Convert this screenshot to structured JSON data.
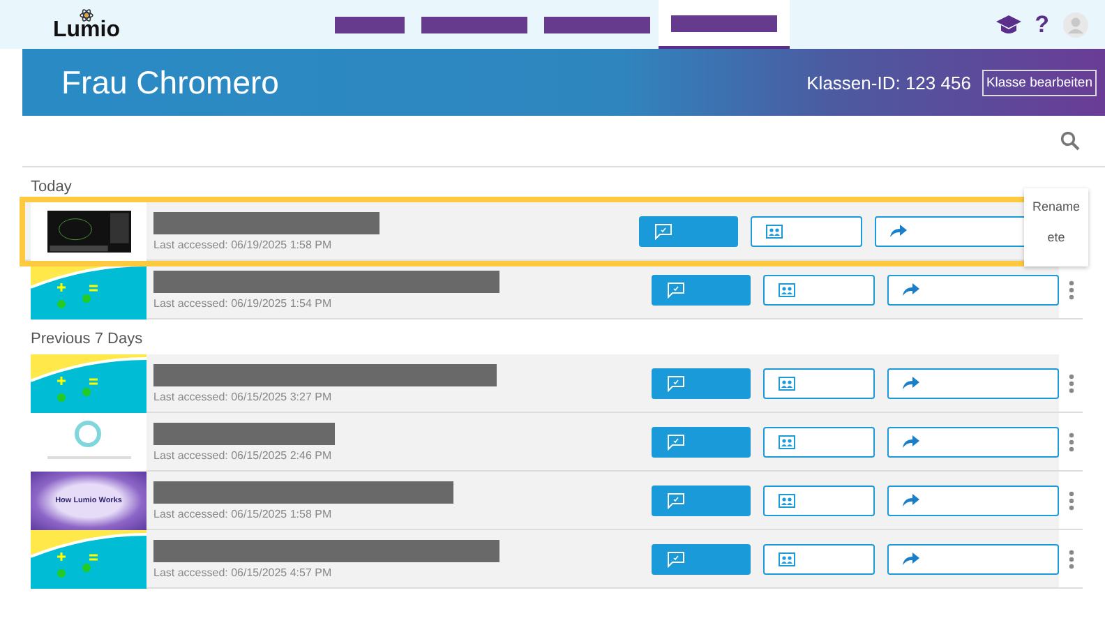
{
  "logo": "Lumio",
  "tabs": [
    {
      "selected": false
    },
    {
      "selected": false
    },
    {
      "selected": false
    },
    {
      "selected": true
    }
  ],
  "help_glyph": "?",
  "banner": {
    "title": "Frau Chromero",
    "class_id": "Klassen-ID: 123 456",
    "edit_button": "Klasse bearbeiten"
  },
  "sections": [
    {
      "heading": "Today",
      "rows": [
        {
          "thumbnail": {
            "kind": "dark"
          },
          "accessed": "Last accessed: 06/19/2025 1:58 PM",
          "highlighted": true,
          "menu": [
            "Rename",
            "ete"
          ]
        },
        {
          "thumbnail": {
            "kind": "math"
          },
          "accessed": "Last accessed: 06/19/2025 1:54 PM",
          "highlighted": false
        }
      ]
    },
    {
      "heading": "Previous 7 Days",
      "rows": [
        {
          "thumbnail": {
            "kind": "math"
          },
          "accessed": "Last accessed: 06/15/2025 3:27 PM",
          "highlighted": false
        },
        {
          "thumbnail": {
            "kind": "ring"
          },
          "accessed": "Last accessed: 06/15/2025 2:46 PM",
          "highlighted": false
        },
        {
          "thumbnail": {
            "kind": "purple",
            "caption": "How Lumio Works"
          },
          "accessed": "Last accessed: 06/15/2025 1:58 PM",
          "highlighted": false
        },
        {
          "thumbnail": {
            "kind": "math"
          },
          "accessed": "Last accessed: 06/15/2025 4:57 PM",
          "highlighted": false
        }
      ]
    }
  ]
}
